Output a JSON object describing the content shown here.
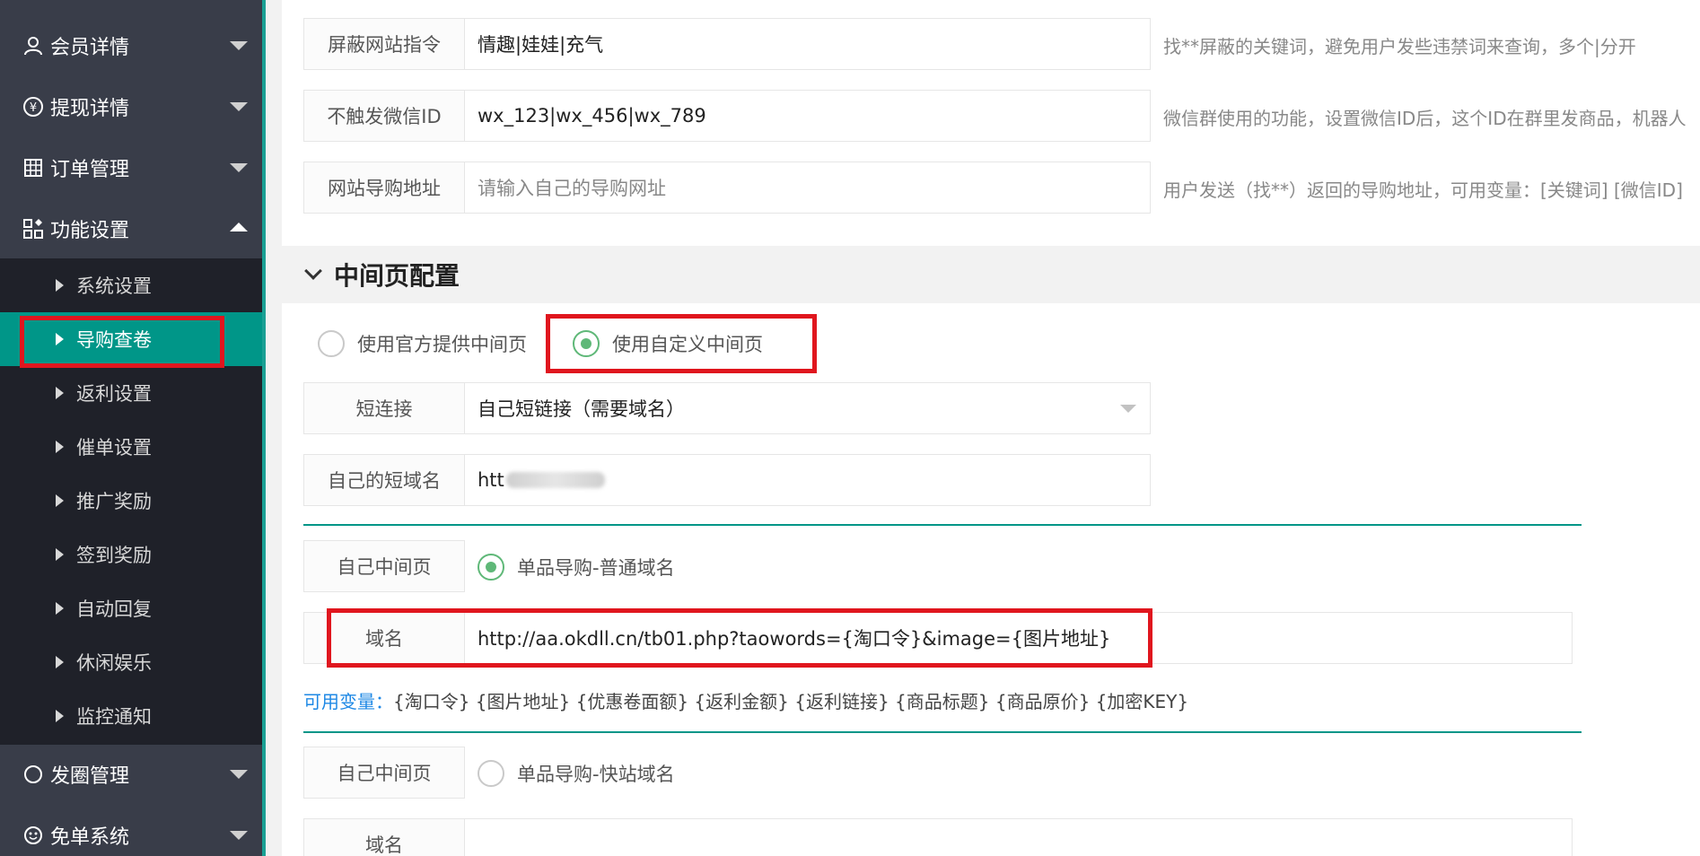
{
  "sidebar": {
    "items": [
      {
        "label": "会员详情",
        "icon": "user-icon"
      },
      {
        "label": "提现详情",
        "icon": "yen-icon"
      },
      {
        "label": "订单管理",
        "icon": "grid-icon"
      },
      {
        "label": "功能设置",
        "icon": "apps-icon"
      },
      {
        "label": "发圈管理",
        "icon": "circle-icon"
      },
      {
        "label": "免单系统",
        "icon": "smile-icon"
      }
    ],
    "submenu": [
      "系统设置",
      "导购查卷",
      "返利设置",
      "催单设置",
      "推广奖励",
      "签到奖励",
      "自动回复",
      "休闲娱乐",
      "监控通知"
    ]
  },
  "form": {
    "block_cmd": {
      "label": "屏蔽网站指令",
      "value": "情趣|娃娃|充气",
      "hint": "找**屏蔽的关键词，避免用户发些违禁词来查询，多个|分开"
    },
    "no_trigger": {
      "label": "不触发微信ID",
      "value": "wx_123|wx_456|wx_789",
      "hint": "微信群使用的功能，设置微信ID后，这个ID在群里发商品，机器人"
    },
    "guide_url": {
      "label": "网站导购地址",
      "placeholder": "请输入自己的导购网址",
      "hint": "用户发送（找**）返回的导购地址，可用变量：[关键词] [微信ID]"
    }
  },
  "section": {
    "title": "中间页配置"
  },
  "radios": {
    "official": "使用官方提供中间页",
    "custom": "使用自定义中间页"
  },
  "short_link": {
    "label": "短连接",
    "value": "自己短链接（需要域名）"
  },
  "own_domain": {
    "label": "自己的短域名",
    "value": "htt"
  },
  "mid1": {
    "label": "自己中间页",
    "option": "单品导购-普通域名",
    "domain_label": "域名",
    "domain_value": "http://aa.okdll.cn/tb01.php?taowords={淘口令}&image={图片地址}"
  },
  "vars": {
    "prefix": "可用变量：",
    "list": "{淘口令} {图片地址} {优惠卷面额} {返利金额} {返利链接} {商品标题} {商品原价} {加密KEY}"
  },
  "mid2": {
    "label": "自己中间页",
    "option": "单品导购-快站域名",
    "domain_label": "域名"
  },
  "colors": {
    "accent": "#009688",
    "sidebar": "#393d49",
    "highlight": "#e0161e",
    "radio_on": "#5fb878"
  }
}
